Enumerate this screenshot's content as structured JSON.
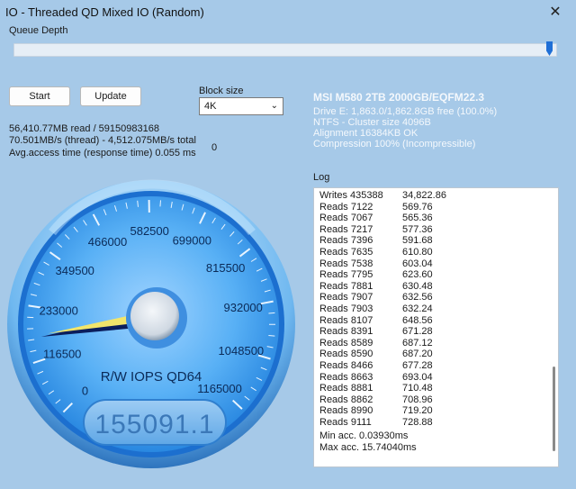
{
  "window": {
    "title": "IO - Threaded QD Mixed IO (Random)",
    "close_glyph": "✕"
  },
  "queue_depth": {
    "label": "Queue Depth",
    "value": 1.0
  },
  "buttons": {
    "start": "Start",
    "update": "Update"
  },
  "block_size": {
    "label": "Block size",
    "selected": "4K"
  },
  "stats": {
    "line1": "56,410.77MB read / 59150983168",
    "line2": "70.501MB/s (thread) - 4,512.075MB/s total",
    "line3": "Avg.access time (response time) 0.055 ms",
    "counter": "0"
  },
  "drive": {
    "name": "MSI M580 2TB 2000GB/EQFM22.3",
    "line1": "Drive E: 1,863.0/1,862.8GB free (100.0%)",
    "line2": "NTFS - Cluster size 4096B",
    "line3": "Alignment 16384KB OK",
    "line4": "Compression 100% (Incompressible)"
  },
  "log": {
    "label": "Log",
    "rows": [
      {
        "k": "Writes 435388",
        "v": "34,822.86"
      },
      {
        "k": "Reads 7122",
        "v": "569.76"
      },
      {
        "k": "Reads 7067",
        "v": "565.36"
      },
      {
        "k": "Reads 7217",
        "v": "577.36"
      },
      {
        "k": "Reads 7396",
        "v": "591.68"
      },
      {
        "k": "Reads 7635",
        "v": "610.80"
      },
      {
        "k": "Reads 7538",
        "v": "603.04"
      },
      {
        "k": "Reads 7795",
        "v": "623.60"
      },
      {
        "k": "Reads 7881",
        "v": "630.48"
      },
      {
        "k": "Reads 7907",
        "v": "632.56"
      },
      {
        "k": "Reads 7903",
        "v": "632.24"
      },
      {
        "k": "Reads 8107",
        "v": "648.56"
      },
      {
        "k": "Reads 8391",
        "v": "671.28"
      },
      {
        "k": "Reads 8589",
        "v": "687.12"
      },
      {
        "k": "Reads 8590",
        "v": "687.20"
      },
      {
        "k": "Reads 8466",
        "v": "677.28"
      },
      {
        "k": "Reads 8663",
        "v": "693.04"
      },
      {
        "k": "Reads 8881",
        "v": "710.48"
      },
      {
        "k": "Reads 8862",
        "v": "708.96"
      },
      {
        "k": "Reads 8990",
        "v": "719.20"
      },
      {
        "k": "Reads 9111",
        "v": "728.88"
      }
    ],
    "min_acc": "Min acc. 0.03930ms",
    "max_acc": "Max acc. 15.74040ms"
  },
  "gauge": {
    "ticks": [
      "0",
      "116500",
      "233000",
      "349500",
      "466000",
      "582500",
      "699000",
      "815500",
      "932000",
      "1048500",
      "1165000"
    ],
    "max": 1165000,
    "value": 155091.1,
    "label": "R/W IOPS QD64",
    "digital": "155091.1"
  },
  "colors": {
    "accent": "#1f6fd6",
    "gauge_blue": "#2f8fe6",
    "needle": "#0b1e5c",
    "needle_highlight": "#f2e56b"
  }
}
